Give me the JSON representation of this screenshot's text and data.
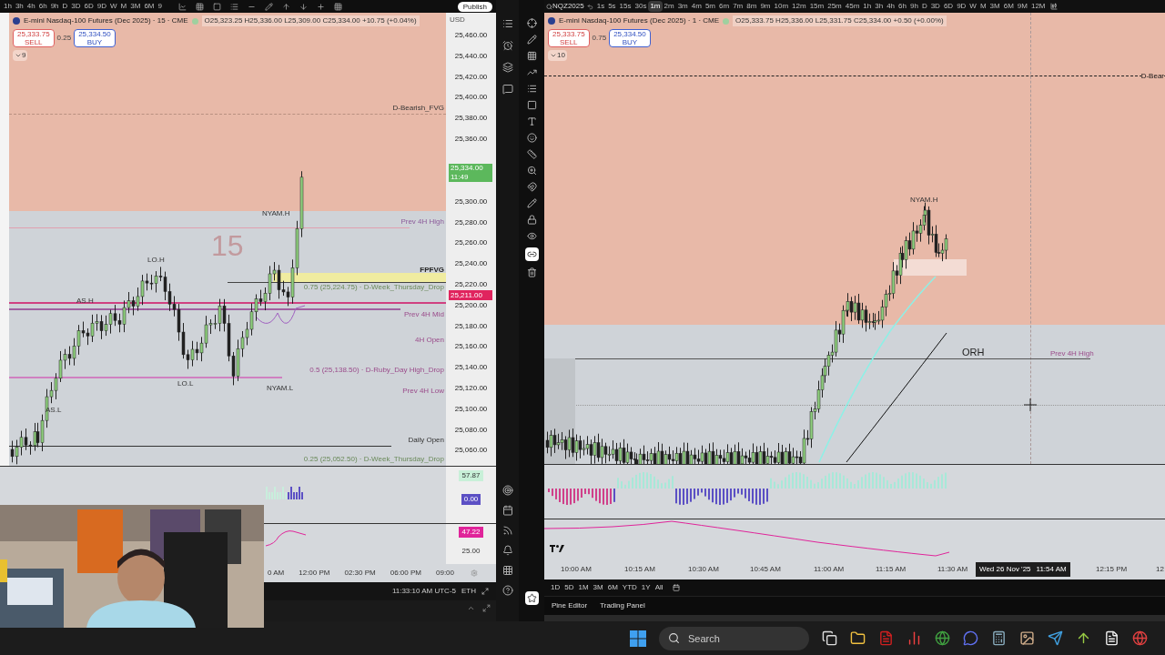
{
  "left_chart": {
    "timeframes": [
      {
        "label": "1h",
        "selected": false
      },
      {
        "label": "3h",
        "selected": false
      },
      {
        "label": "4h",
        "selected": false
      },
      {
        "label": "6h",
        "selected": false
      },
      {
        "label": "9h",
        "selected": false
      },
      {
        "label": "D",
        "selected": false
      },
      {
        "label": "3D",
        "selected": false
      },
      {
        "label": "6D",
        "selected": false
      },
      {
        "label": "9D",
        "selected": false
      },
      {
        "label": "W",
        "selected": false
      },
      {
        "label": "M",
        "selected": false
      },
      {
        "label": "3M",
        "selected": false
      },
      {
        "label": "6M",
        "selected": false
      },
      {
        "label": "9",
        "selected": false
      }
    ],
    "publish": "Publish",
    "title": "E-mini Nasdaq-100 Futures (Dec 2025) · 15 · CME",
    "ohlc": "O25,323.25 H25,336.00 L25,309.00 C25,334.00 +10.75 (+0.04%)",
    "sell": {
      "price": "25,333.75",
      "label": "SELL"
    },
    "spread": "0.25",
    "buy": {
      "price": "25,334.50",
      "label": "BUY"
    },
    "indicator_count": "9",
    "currency": "USD",
    "watermark": "15",
    "price_ticks": [
      "25,460.00",
      "25,440.00",
      "25,420.00",
      "25,400.00",
      "25,380.00",
      "25,360.00",
      "25,300.00",
      "25,280.00",
      "25,260.00",
      "25,240.00",
      "25,220.00",
      "25,200.00",
      "25,180.00",
      "25,160.00",
      "25,140.00",
      "25,120.00",
      "25,100.00",
      "25,080.00",
      "25,060.00"
    ],
    "price_badges": [
      {
        "price": "25,334.00",
        "countdown": "11:49",
        "color": "#5cb85c"
      },
      {
        "price": "25,211.00",
        "color": "#e0245e"
      }
    ],
    "labels": [
      "D-Bearish_FVG",
      "NYAM.H",
      "Prev 4H High",
      "LO.H",
      "AS.H",
      "FPFVG",
      "0.75 (25,224.75) · D-Week_Thursday_Drop",
      "Prev 4H Mid",
      "4H Open",
      "0.5 (25,138.50) · D-Ruby_Day High_Drop",
      "LO.L",
      "NYAM.L",
      "Prev 4H Low",
      "AS.L",
      "Daily Open",
      "0.25 (25,052.50) · D-Week_Thursday_Drop"
    ],
    "pane_values": [
      {
        "text": "57.87",
        "color": "#c8f0d8"
      },
      {
        "text": "0.00",
        "color": "#5b4fc4"
      },
      {
        "text": "47.22",
        "color": "#e0249a"
      },
      {
        "text": "25.00"
      }
    ],
    "time_ticks": [
      "0 AM",
      "12:00 PM",
      "02:30 PM",
      "06:00 PM",
      "09:00"
    ],
    "clock": "11:33:10 AM UTC-5",
    "session": "ETH"
  },
  "right_chart": {
    "symbol": "NQZ2025",
    "timeframes": [
      {
        "label": "1s",
        "selected": false
      },
      {
        "label": "5s",
        "selected": false
      },
      {
        "label": "15s",
        "selected": false
      },
      {
        "label": "30s",
        "selected": false
      },
      {
        "label": "1m",
        "selected": true
      },
      {
        "label": "2m",
        "selected": false
      },
      {
        "label": "3m",
        "selected": false
      },
      {
        "label": "4m",
        "selected": false
      },
      {
        "label": "5m",
        "selected": false
      },
      {
        "label": "6m",
        "selected": false
      },
      {
        "label": "7m",
        "selected": false
      },
      {
        "label": "8m",
        "selected": false
      },
      {
        "label": "9m",
        "selected": false
      },
      {
        "label": "10m",
        "selected": false
      },
      {
        "label": "12m",
        "selected": false
      },
      {
        "label": "15m",
        "selected": false
      },
      {
        "label": "25m",
        "selected": false
      },
      {
        "label": "45m",
        "selected": false
      },
      {
        "label": "1h",
        "selected": false
      },
      {
        "label": "3h",
        "selected": false
      },
      {
        "label": "4h",
        "selected": false
      },
      {
        "label": "6h",
        "selected": false
      },
      {
        "label": "9h",
        "selected": false
      },
      {
        "label": "D",
        "selected": false
      },
      {
        "label": "3D",
        "selected": false
      },
      {
        "label": "6D",
        "selected": false
      },
      {
        "label": "9D",
        "selected": false
      },
      {
        "label": "W",
        "selected": false
      },
      {
        "label": "M",
        "selected": false
      },
      {
        "label": "3M",
        "selected": false
      },
      {
        "label": "6M",
        "selected": false
      },
      {
        "label": "9M",
        "selected": false
      },
      {
        "label": "12M",
        "selected": false
      }
    ],
    "title": "E-mini Nasdaq-100 Futures (Dec 2025) · 1 · CME",
    "ohlc": "O25,333.75 H25,336.00 L25,331.75 C25,334.00 +0.50 (+0.00%)",
    "sell": {
      "price": "25,333.75",
      "label": "SELL"
    },
    "spread": "0.75",
    "buy": {
      "price": "25,334.50",
      "label": "BUY"
    },
    "indicator_count": "10",
    "labels": [
      "D-Bear",
      "NYAM.H",
      "ORH",
      "Prev 4H High"
    ],
    "time_ticks": [
      "10:00 AM",
      "10:15 AM",
      "10:30 AM",
      "10:45 AM",
      "11:00 AM",
      "11:15 AM",
      "11:30 AM",
      "12:15 PM",
      "12"
    ],
    "crosshair_date": "Wed 26 Nov '25",
    "crosshair_time": "11:54 AM",
    "ranges": [
      "1D",
      "5D",
      "1M",
      "3M",
      "6M",
      "YTD",
      "1Y",
      "All"
    ],
    "bottom_tabs": [
      "Pine Editor",
      "Trading Panel"
    ]
  },
  "taskbar": {
    "search_placeholder": "Search"
  }
}
